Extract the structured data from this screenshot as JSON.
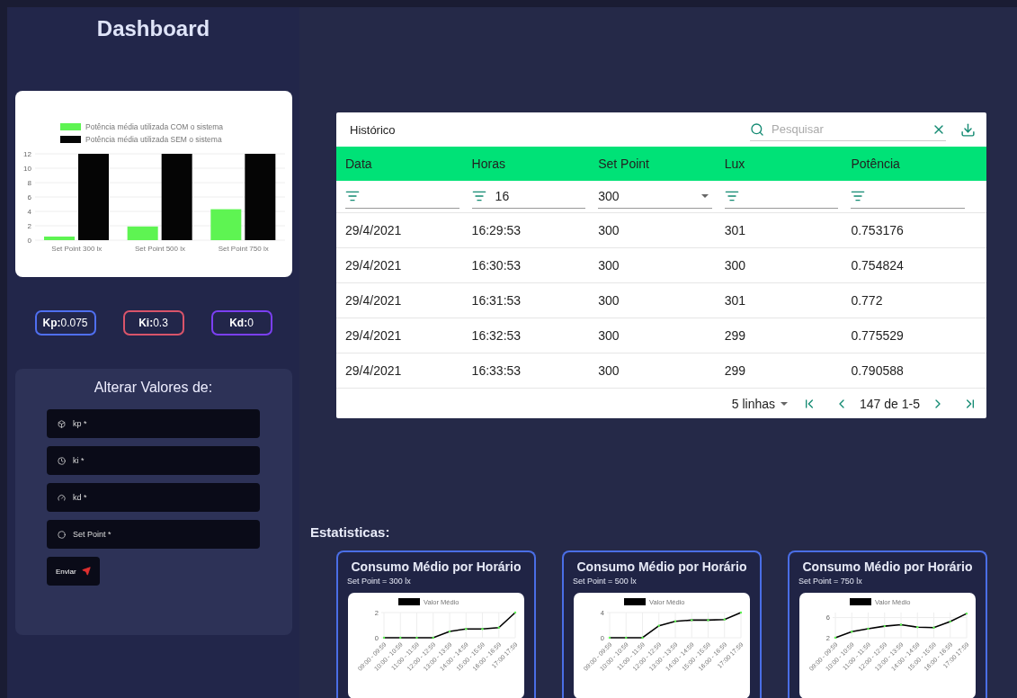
{
  "sidebar": {
    "title": "Dashboard",
    "chart": {
      "chart_data": {
        "type": "bar",
        "categories": [
          "Set Point 300 lx",
          "Set Point 500 lx",
          "Set Point 750 lx"
        ],
        "series": [
          {
            "name": "Potência média utilizada COM o sistema",
            "color": "#5ef452",
            "values": [
              0.5,
              1.9,
              4.3
            ]
          },
          {
            "name": "Potência média utilizada SEM o sistema",
            "color": "#050505",
            "values": [
              12,
              12,
              12
            ]
          }
        ],
        "ylim": [
          0,
          12
        ],
        "yticks": [
          0,
          2,
          4,
          6,
          8,
          10,
          12
        ],
        "grid": true,
        "legend": "top"
      }
    },
    "gains": [
      {
        "text": "**Kp:**0.075",
        "color": "#4f6ff0"
      },
      {
        "text": "**Ki:**0.3",
        "color": "#d9546a"
      },
      {
        "text": "**Kd:**0",
        "color": "#7b3ff2"
      }
    ],
    "form": {
      "title": "Alterar Valores de:",
      "fields": [
        {
          "placeholder": "kp *",
          "kind": "box"
        },
        {
          "placeholder": "ki *",
          "kind": "clock"
        },
        {
          "placeholder": "kd *",
          "kind": "gauge"
        },
        {
          "placeholder": "Set Point *",
          "kind": "circle"
        }
      ],
      "submit": "Enviar"
    }
  },
  "table": {
    "title": "Histórico",
    "search": {
      "placeholder": "Pesquisar"
    },
    "columns": [
      "Data",
      "Horas",
      "Set Point",
      "Lux",
      "Potência"
    ],
    "filters": [
      {
        "kind": "filter"
      },
      {
        "kind": "filter",
        "value": "16"
      },
      {
        "kind": "select",
        "value": "300"
      },
      {
        "kind": "filter"
      },
      {
        "kind": "filter"
      }
    ],
    "rows": [
      [
        "29/4/2021",
        "16:29:53",
        "300",
        "301",
        "0.753176"
      ],
      [
        "29/4/2021",
        "16:30:53",
        "300",
        "300",
        "0.754824"
      ],
      [
        "29/4/2021",
        "16:31:53",
        "300",
        "301",
        "0.772"
      ],
      [
        "29/4/2021",
        "16:32:53",
        "300",
        "299",
        "0.775529"
      ],
      [
        "29/4/2021",
        "16:33:53",
        "300",
        "299",
        "0.790588"
      ]
    ],
    "pagination": {
      "rows_per_page": "5 linhas",
      "range": "147 de 1-5"
    }
  },
  "statistics": {
    "title": "Estatisticas:",
    "cards": [
      {
        "title": "Consumo Médio por Horário",
        "subtitle": "Set Point = 300 lx",
        "chart_data": {
          "type": "line",
          "categories": [
            "09:00 - 09:59",
            "10:00 - 10:59",
            "11:00 - 11:59",
            "12:00 - 12:59",
            "13:00 - 13:59",
            "14:00 - 14:59",
            "15:00 - 15:59",
            "16:00 - 16:59",
            "17:00 17:59"
          ],
          "series": [
            {
              "name": "Valor Médio",
              "color": "#000000",
              "values": [
                0,
                0,
                0,
                0,
                0.5,
                0.7,
                0.7,
                0.8,
                2
              ]
            }
          ],
          "ylim": [
            0,
            2
          ],
          "yticks": [
            0,
            2
          ],
          "grid": true,
          "legend": "top"
        }
      },
      {
        "title": "Consumo Médio por Horário",
        "subtitle": "Set Point = 500 lx",
        "chart_data": {
          "type": "line",
          "categories": [
            "09:00 - 09:59",
            "10:00 - 10:59",
            "11:00 - 11:59",
            "12:00 - 12:59",
            "13:00 - 13:59",
            "14:00 - 14:59",
            "15:00 - 15:59",
            "16:00 - 16:59",
            "17:00 17:59"
          ],
          "series": [
            {
              "name": "Valor Médio",
              "color": "#000000",
              "values": [
                0,
                0,
                0,
                1.9,
                2.6,
                2.8,
                2.8,
                2.9,
                4
              ]
            }
          ],
          "ylim": [
            0,
            4
          ],
          "yticks": [
            0,
            4
          ],
          "grid": true,
          "legend": "top"
        }
      },
      {
        "title": "Consumo Médio por Horário",
        "subtitle": "Set Point = 750 lx",
        "chart_data": {
          "type": "line",
          "categories": [
            "09:00 - 09:59",
            "10:00 - 10:59",
            "11:00 - 11:59",
            "12:00 - 12:59",
            "13:00 - 13:59",
            "14:00 - 14:59",
            "15:00 - 15:59",
            "16:00 - 16:59",
            "17:00 17:59"
          ],
          "series": [
            {
              "name": "Valor Médio",
              "color": "#000000",
              "values": [
                2,
                3.2,
                3.8,
                4.3,
                4.6,
                4.1,
                4,
                5.2,
                6.8
              ]
            }
          ],
          "ylim": [
            2,
            7
          ],
          "yticks": [
            2,
            6
          ],
          "grid": true,
          "legend": "top"
        }
      }
    ]
  }
}
